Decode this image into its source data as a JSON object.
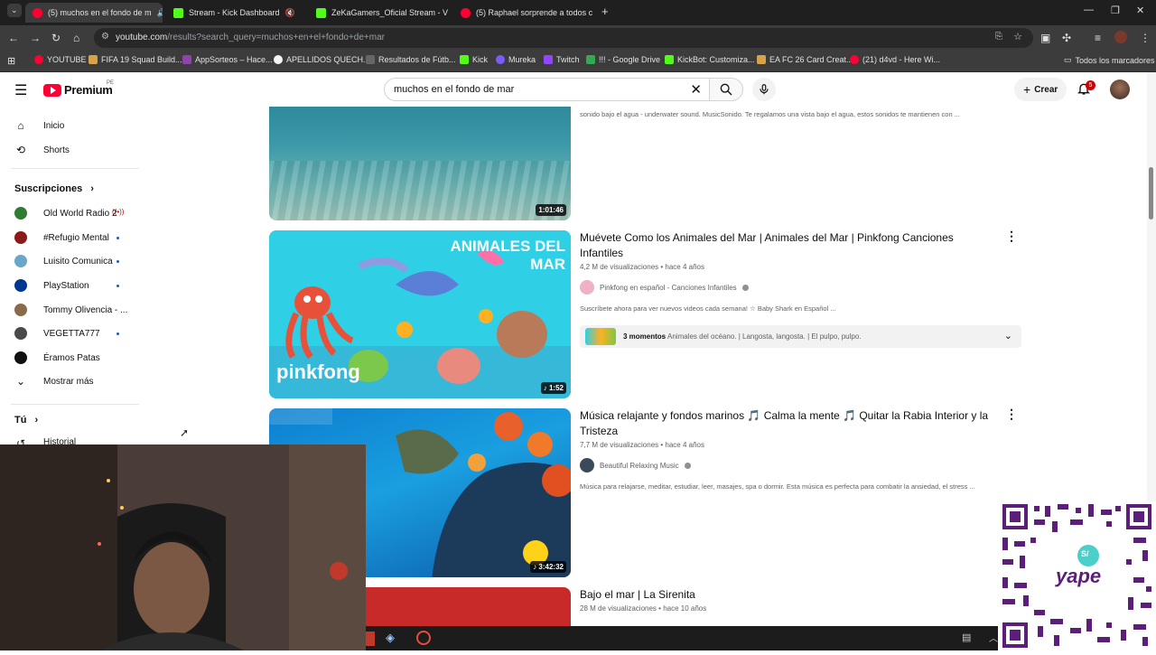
{
  "browser": {
    "tabs": [
      {
        "label": "(5) muchos en el fondo de m",
        "icon": "youtube"
      },
      {
        "label": "Stream - Kick Dashboard",
        "icon": "kick"
      },
      {
        "label": "ZeKaGamers_Oficial Stream - V",
        "icon": "kick"
      },
      {
        "label": "(5) Raphael sorprende a todos c",
        "icon": "youtube"
      }
    ],
    "url_host": "youtube.com",
    "url_path": "/results?search_query=muchos+en+el+fondo+de+mar",
    "bookmarks": [
      {
        "label": "YOUTUBE",
        "color": "#ff0033"
      },
      {
        "label": "FIFA 19 Squad Build...",
        "color": "#d6a24a"
      },
      {
        "label": "AppSorteos – Hace...",
        "color": "#8e44ad"
      },
      {
        "label": "APELLIDOS QUECH...",
        "color": "#f4f4f4"
      },
      {
        "label": "Resultados de Fútb...",
        "color": "#666666"
      },
      {
        "label": "Kick",
        "color": "#53fc18"
      },
      {
        "label": "Mureka",
        "color": "#7d5cff"
      },
      {
        "label": "Twitch",
        "color": "#9146ff"
      },
      {
        "label": "!!! - Google Drive",
        "color": "#34a853"
      },
      {
        "label": "KickBot: Customiza...",
        "color": "#53fc18"
      },
      {
        "label": "EA FC 26 Card Creat...",
        "color": "#d6a24a"
      },
      {
        "label": "(21) d4vd - Here Wi...",
        "color": "#ff0033"
      }
    ],
    "all_bookmarks": "Todos los marcadores"
  },
  "header": {
    "logo": "Premium",
    "logo_country": "PE",
    "search_value": "muchos en el fondo de mar",
    "create_label": "Crear",
    "notifications_count": "5"
  },
  "sidebar": {
    "main": [
      {
        "label": "Inicio",
        "icon": "home-icon"
      },
      {
        "label": "Shorts",
        "icon": "shorts-icon"
      }
    ],
    "subscriptions_title": "Suscripciones",
    "subscriptions": [
      {
        "label": "Old World Radio 2",
        "color": "#2e7d32",
        "live": true
      },
      {
        "label": "#Refugio Mental",
        "color": "#8b1a1a",
        "dot": true
      },
      {
        "label": "Luisito Comunica",
        "color": "#6aa6c8",
        "dot": true
      },
      {
        "label": "PlayStation",
        "color": "#003791",
        "dot": true
      },
      {
        "label": "Tommy Olivencia - ...",
        "color": "#8a6a4a",
        "dot": false
      },
      {
        "label": "VEGETTA777",
        "color": "#4a4a4a",
        "dot": true
      },
      {
        "label": "Éramos Patas",
        "color": "#111111",
        "dot": false
      }
    ],
    "show_more": "Mostrar más",
    "you_title": "Tú",
    "history": "Historial"
  },
  "results": [
    {
      "duration": "1:01:46",
      "description": "sonido bajo el agua - underwater sound. MusicSonido. Te regalamos una vista bajo el agua, estos sonidos te mantienen con ..."
    },
    {
      "title": "Muévete Como los Animales del Mar | Animales del Mar | Pinkfong Canciones Infantiles",
      "views": "4,2 M de visualizaciones",
      "age": "hace 4 años",
      "channel": "Pinkfong en español - Canciones Infantiles",
      "description": "Suscríbete ahora para ver nuevos videos cada semana! ☆ Baby Shark en Español ...",
      "duration": "1:52",
      "thumb_title": "ANIMALES DEL MAR",
      "thumb_brand": "pinkfong",
      "moments_count": "3 momentos",
      "moments_text": "Animales del océano. | Langosta, langosta. | El pulpo, pulpo."
    },
    {
      "title": "Música relajante y fondos marinos 🎵 Calma la mente 🎵 Quitar la Rabia Interior y la Tristeza",
      "views": "7,7 M de visualizaciones",
      "age": "hace 4 años",
      "channel": "Beautiful Relaxing Music",
      "description": "Música para relajarse, meditar, estudiar, leer, masajes, spa o dormir. Esta música es perfecta para combatir la ansiedad, el stress ...",
      "duration": "3:42:32"
    },
    {
      "title": "Bajo el mar | La Sirenita",
      "views": "28 M de visualizaciones",
      "age": "hace 10 años"
    }
  ],
  "overlay": {
    "qr_brand": "yape",
    "qr_prefix": "S/"
  }
}
